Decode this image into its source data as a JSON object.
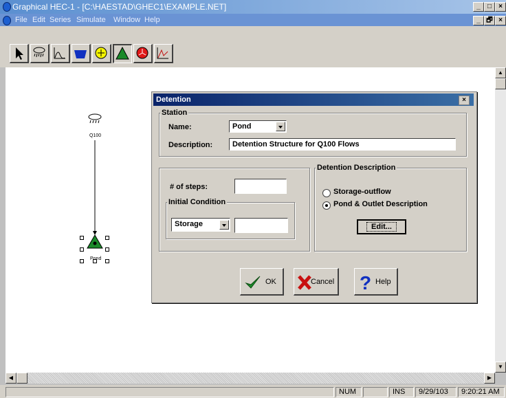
{
  "window": {
    "title": "Graphical HEC-1 - [C:\\HAESTAD\\GHEC1\\EXAMPLE.NET]",
    "controls": [
      "_",
      "□",
      "×"
    ],
    "child_controls": [
      "_",
      "🗗",
      "×"
    ]
  },
  "menu": [
    "File",
    "Edit",
    "Series",
    "Simulate",
    "Window",
    "Help"
  ],
  "toolbar": [
    "pointer-icon",
    "rain-gauge-icon",
    "hydrograph-icon",
    "reservoir-icon",
    "junction-icon",
    "detention-icon",
    "diversion-icon",
    "output-graph-icon"
  ],
  "canvas": {
    "nodes": [
      {
        "label": "Q100",
        "icon": "rain-cloud-icon"
      },
      {
        "label": "Pond",
        "icon": "detention-icon"
      }
    ]
  },
  "dialog": {
    "title": "Detention",
    "station": {
      "group_label": "Station",
      "name_label": "Name:",
      "name_value": "Pond",
      "description_label": "Description:",
      "description_value": "Detention Structure for Q100 Flows"
    },
    "steps_label": "# of steps:",
    "steps_value": "",
    "initial_condition": {
      "group_label": "Initial Condition",
      "type_value": "Storage",
      "amount_value": ""
    },
    "detention_description": {
      "group_label": "Detention Description",
      "options": [
        "Storage-outflow",
        "Pond & Outlet Description"
      ],
      "selected_index": 1,
      "edit_label": "Edit..."
    },
    "buttons": {
      "ok": "OK",
      "cancel": "Cancel",
      "help": "Help"
    }
  },
  "status": {
    "num": "NUM",
    "ins": "INS",
    "date": "9/29/103",
    "time": "9:20:21 AM"
  },
  "colors": {
    "title_bar": "#5a8fd0",
    "dialog_title": "#0a246a",
    "detention_green": "#1a8a2a"
  }
}
